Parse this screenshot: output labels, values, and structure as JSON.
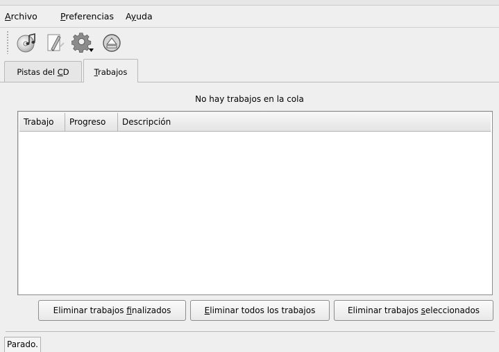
{
  "menubar": {
    "items": [
      {
        "accel": "A",
        "rest": "rchivo"
      },
      {
        "accel": "P",
        "rest": "referencias"
      },
      {
        "pre": "A",
        "accel": "y",
        "rest": "uda"
      }
    ]
  },
  "toolbar": {
    "icons": [
      "cd-music-icon",
      "edit-pencil-icon",
      "gear-settings-icon",
      "eject-icon"
    ]
  },
  "tabs": [
    {
      "pre": "Pistas del ",
      "accel": "C",
      "rest": "D",
      "active": false
    },
    {
      "pre": "",
      "accel": "T",
      "rest": "rabajos",
      "active": true
    }
  ],
  "jobs": {
    "status_message": "No hay trabajos en la cola",
    "columns": [
      "Trabajo",
      "Progreso",
      "Descripción"
    ],
    "rows": []
  },
  "buttons": {
    "remove_finished": {
      "pre": "Eliminar trabajos ",
      "accel": "f",
      "rest": "inalizados"
    },
    "remove_all": {
      "pre": "",
      "accel": "E",
      "rest": "liminar todos los trabajos"
    },
    "remove_selected": {
      "pre": "Eliminar trabajos ",
      "accel": "s",
      "rest": "eleccionados"
    }
  },
  "statusbar": {
    "text": "Parado."
  }
}
